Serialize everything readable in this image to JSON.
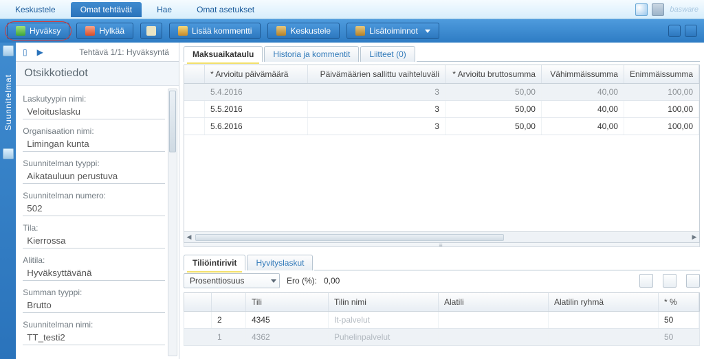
{
  "top_tabs": {
    "chat": "Keskustele",
    "tasks": "Omat tehtävät",
    "search": "Hae",
    "settings": "Omat asetukset"
  },
  "brand": "basware",
  "toolbar": {
    "approve": "Hyväksy",
    "reject": "Hylkää",
    "add_comment": "Lisää kommentti",
    "discuss": "Keskustele",
    "more": "Lisätoiminnot"
  },
  "rail_label": "Suunnitelmat",
  "task_nav": "Tehtävä 1/1: Hyväksyntä",
  "sidebar": {
    "title": "Otsikkotiedot",
    "fields": {
      "invoice_type_label": "Laskutyypin nimi:",
      "invoice_type_value": "Veloituslasku",
      "org_label": "Organisaation nimi:",
      "org_value": "Limingan kunta",
      "plan_type_label": "Suunnitelman tyyppi:",
      "plan_type_value": "Aikatauluun perustuva",
      "plan_no_label": "Suunnitelman numero:",
      "plan_no_value": "502",
      "status_label": "Tila:",
      "status_value": "Kierrossa",
      "substatus_label": "Alitila:",
      "substatus_value": "Hyväksyttävänä",
      "sum_type_label": "Summan tyyppi:",
      "sum_type_value": "Brutto",
      "plan_name_label": "Suunnitelman nimi:",
      "plan_name_value": "TT_testi2"
    }
  },
  "upper_tabs": {
    "schedule": "Maksuaikataulu",
    "history": "Historia ja kommentit",
    "attachments": "Liitteet (0)"
  },
  "grid": {
    "headers": {
      "date": "* Arvioitu päivämäärä",
      "range": "Päivämäärien sallittu vaihteluväli",
      "gross": "* Arvioitu bruttosumma",
      "min": "Vähimmäissumma",
      "max": "Enimmäissumma"
    },
    "rows": [
      {
        "date": "5.4.2016",
        "range": "3",
        "gross": "50,00",
        "min": "40,00",
        "max": "100,00"
      },
      {
        "date": "5.5.2016",
        "range": "3",
        "gross": "50,00",
        "min": "40,00",
        "max": "100,00"
      },
      {
        "date": "5.6.2016",
        "range": "3",
        "gross": "50,00",
        "min": "40,00",
        "max": "100,00"
      }
    ]
  },
  "lower_tabs": {
    "rows": "Tiliöintirivit",
    "credit": "Hyvityslaskut"
  },
  "percent": {
    "select": "Prosenttiosuus",
    "diff_label": "Ero (%):",
    "diff_value": "0,00"
  },
  "tili": {
    "headers": {
      "tili": "Tili",
      "name": "Tilin nimi",
      "ala": "Alatili",
      "grp": "Alatilin ryhmä",
      "pct": "* %"
    },
    "rows": [
      {
        "idx": "2",
        "tili": "4345",
        "name": "It-palvelut",
        "pct": "50"
      },
      {
        "idx": "1",
        "tili": "4362",
        "name": "Puhelinpalvelut",
        "pct": "50"
      }
    ]
  }
}
